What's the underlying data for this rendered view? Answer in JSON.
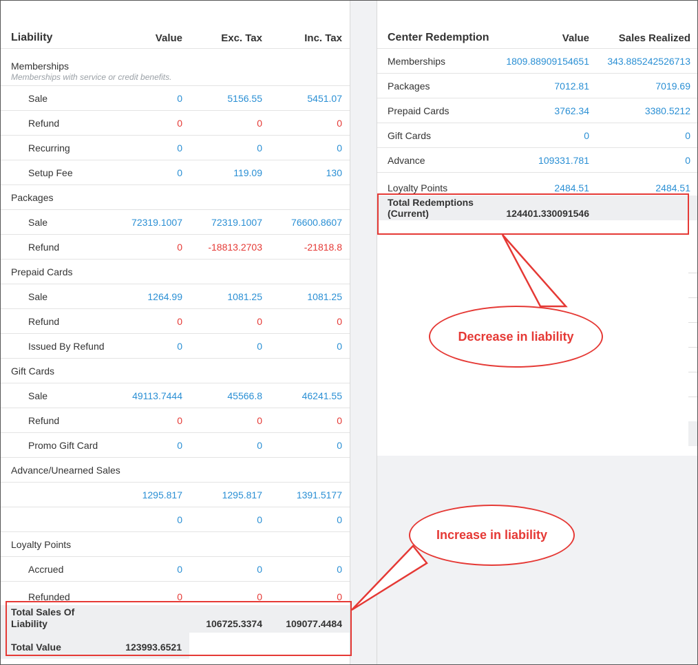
{
  "liability": {
    "header": {
      "title": "Liability",
      "col1": "Value",
      "col2": "Exc. Tax",
      "col3": "Inc. Tax"
    },
    "groups": {
      "memberships": {
        "title": "Memberships",
        "subtitle": "Memberships with service or credit benefits.",
        "rows": [
          {
            "label": "Sale",
            "v1": "0",
            "v2": "5156.55",
            "v3": "5451.07"
          },
          {
            "label": "Refund",
            "v1": "0",
            "v2": "0",
            "v3": "0"
          },
          {
            "label": "Recurring",
            "v1": "0",
            "v2": "0",
            "v3": "0"
          },
          {
            "label": "Setup Fee",
            "v1": "0",
            "v2": "119.09",
            "v3": "130"
          }
        ]
      },
      "packages": {
        "title": "Packages",
        "rows": [
          {
            "label": "Sale",
            "v1": "72319.1007",
            "v2": "72319.1007",
            "v3": "76600.8607"
          },
          {
            "label": "Refund",
            "v1": "0",
            "v2": "-18813.2703",
            "v3": "-21818.8"
          }
        ]
      },
      "prepaid": {
        "title": "Prepaid Cards",
        "rows": [
          {
            "label": "Sale",
            "v1": "1264.99",
            "v2": "1081.25",
            "v3": "1081.25"
          },
          {
            "label": "Refund",
            "v1": "0",
            "v2": "0",
            "v3": "0"
          },
          {
            "label": "Issued By Refund",
            "v1": "0",
            "v2": "0",
            "v3": "0"
          }
        ]
      },
      "gift": {
        "title": "Gift Cards",
        "rows": [
          {
            "label": "Sale",
            "v1": "49113.7444",
            "v2": "45566.8",
            "v3": "46241.55"
          },
          {
            "label": "Refund",
            "v1": "0",
            "v2": "0",
            "v3": "0"
          },
          {
            "label": "Promo Gift Card",
            "v1": "0",
            "v2": "0",
            "v3": "0"
          }
        ]
      },
      "advance": {
        "title": "Advance/Unearned Sales",
        "rows": [
          {
            "label": "",
            "v1": "1295.817",
            "v2": "1295.817",
            "v3": "1391.5177"
          },
          {
            "label": "",
            "v1": "0",
            "v2": "0",
            "v3": "0"
          }
        ]
      },
      "loyalty": {
        "title": "Loyalty Points",
        "rows": [
          {
            "label": "Accrued",
            "v1": "0",
            "v2": "0",
            "v3": "0"
          },
          {
            "label": "Refunded",
            "v1": "0",
            "v2": "0",
            "v3": "0"
          }
        ]
      }
    },
    "total_sales": {
      "label_line1": "Total Sales Of",
      "label_line2": "Liability",
      "v2": "106725.3374",
      "v3": "109077.4484"
    },
    "total_value": {
      "label": "Total Value",
      "v1": "123993.6521"
    }
  },
  "redemption": {
    "header": {
      "title": "Center Redemption",
      "col1": "Value",
      "col2": "Sales Realized"
    },
    "rows": [
      {
        "label": "Memberships",
        "v1": "1809.88909154651",
        "v2": "343.885242526713"
      },
      {
        "label": "Packages",
        "v1": "7012.81",
        "v2": "7019.69"
      },
      {
        "label": "Prepaid Cards",
        "v1": "3762.34",
        "v2": "3380.5212"
      },
      {
        "label": "Gift Cards",
        "v1": "0",
        "v2": "0"
      },
      {
        "label": "Advance",
        "v1": "109331.781",
        "v2": "0"
      },
      {
        "label": "Loyalty Points",
        "v1": "2484.51",
        "v2": "2484.51"
      }
    ],
    "total": {
      "label_line1": "Total Redemptions",
      "label_line2": "(Current)",
      "v1": "124401.330091546"
    }
  },
  "callouts": {
    "decrease": "Decrease in liability",
    "increase": "Increase in liability"
  },
  "colors": {
    "positive": "#2a8fd4",
    "negative": "#e53935",
    "annotation": "#e53935"
  }
}
